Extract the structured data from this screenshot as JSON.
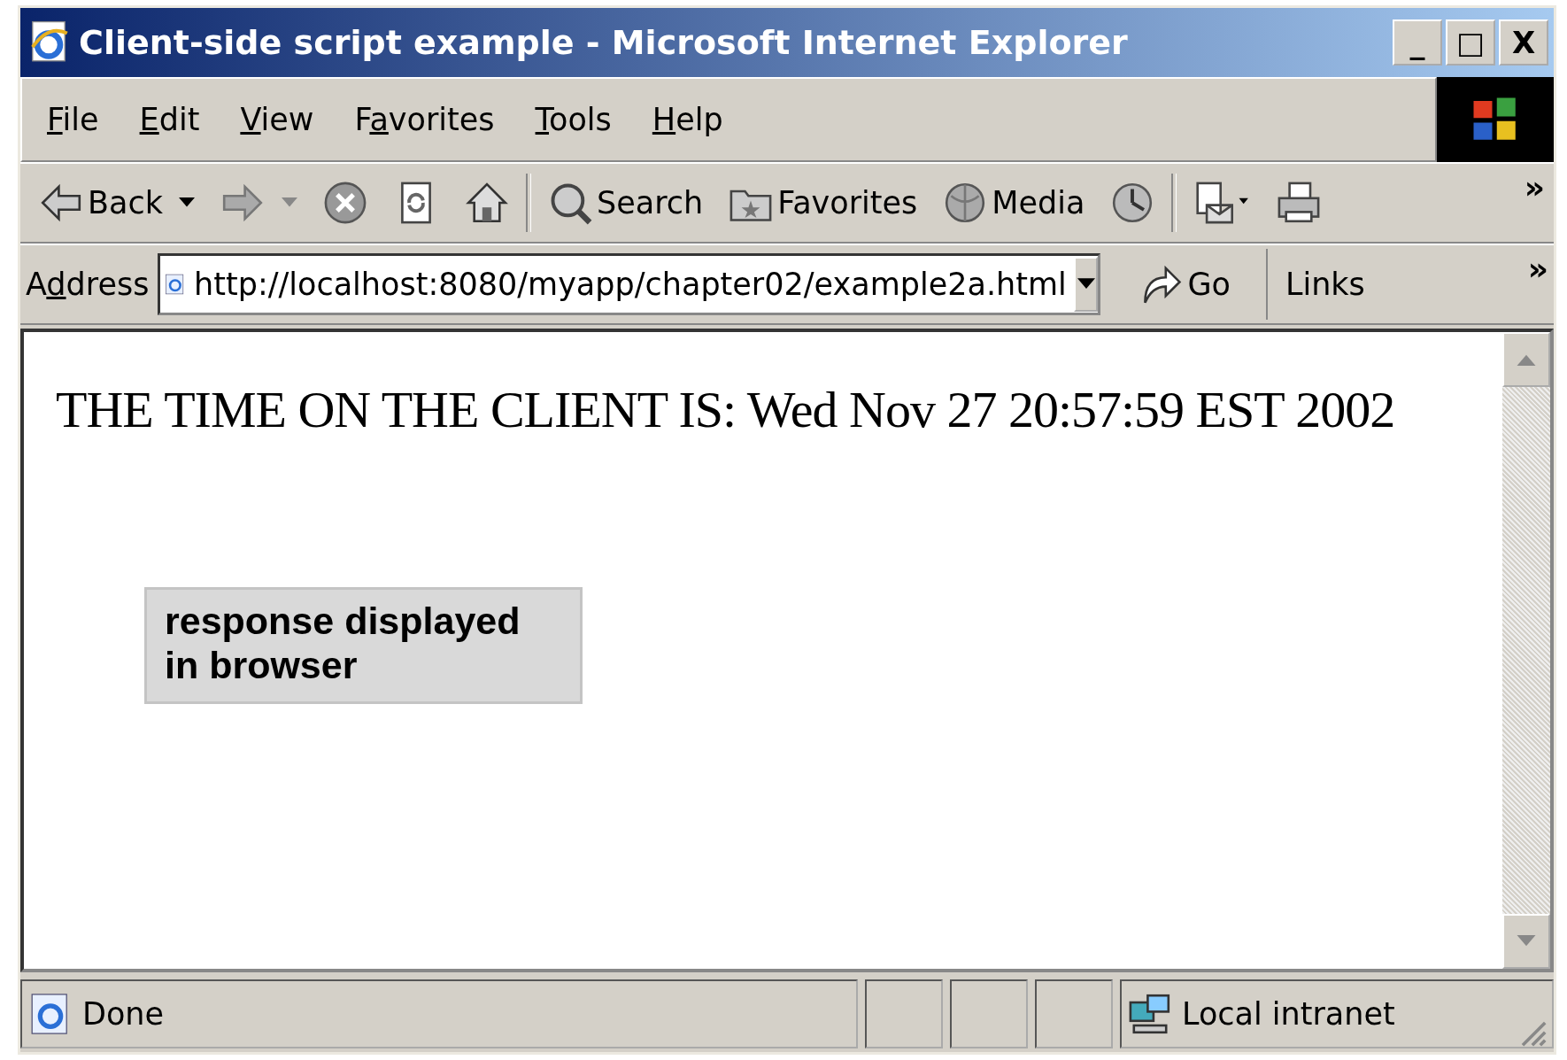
{
  "window": {
    "title": "Client-side script example - Microsoft Internet Explorer",
    "controls": [
      "_",
      "□",
      "X"
    ]
  },
  "menu": [
    {
      "key": "F",
      "rest": "ile"
    },
    {
      "key": "E",
      "rest": "dit"
    },
    {
      "key": "V",
      "rest": "iew"
    },
    {
      "lead": "F",
      "key": "a",
      "rest": "vorites"
    },
    {
      "key": "T",
      "rest": "ools"
    },
    {
      "key": "H",
      "rest": "elp"
    }
  ],
  "toolbar": [
    {
      "kind": "back",
      "label": "Back"
    },
    {
      "kind": "forward"
    },
    {
      "kind": "stop"
    },
    {
      "kind": "refresh"
    },
    {
      "kind": "home"
    },
    {
      "kind": "sep"
    },
    {
      "kind": "search",
      "label": "Search"
    },
    {
      "kind": "favorites",
      "label": "Favorites"
    },
    {
      "kind": "media",
      "label": "Media"
    },
    {
      "kind": "history"
    },
    {
      "kind": "sep"
    },
    {
      "kind": "mail"
    },
    {
      "kind": "print"
    }
  ],
  "toolbar_more": "»",
  "address": {
    "label": {
      "lead": "A",
      "key": "d",
      "rest": "dress"
    },
    "url": "http://localhost:8080/myapp/chapter02/example2a.html",
    "go": "Go",
    "links": "Links",
    "links_more": "»"
  },
  "page": {
    "text": "THE TIME ON THE CLIENT IS: Wed Nov 27 20:57:59 EST 2002"
  },
  "callout": {
    "text": "response displayed in browser"
  },
  "status_bar": {
    "text": "Done",
    "zone": "Local intranet"
  }
}
